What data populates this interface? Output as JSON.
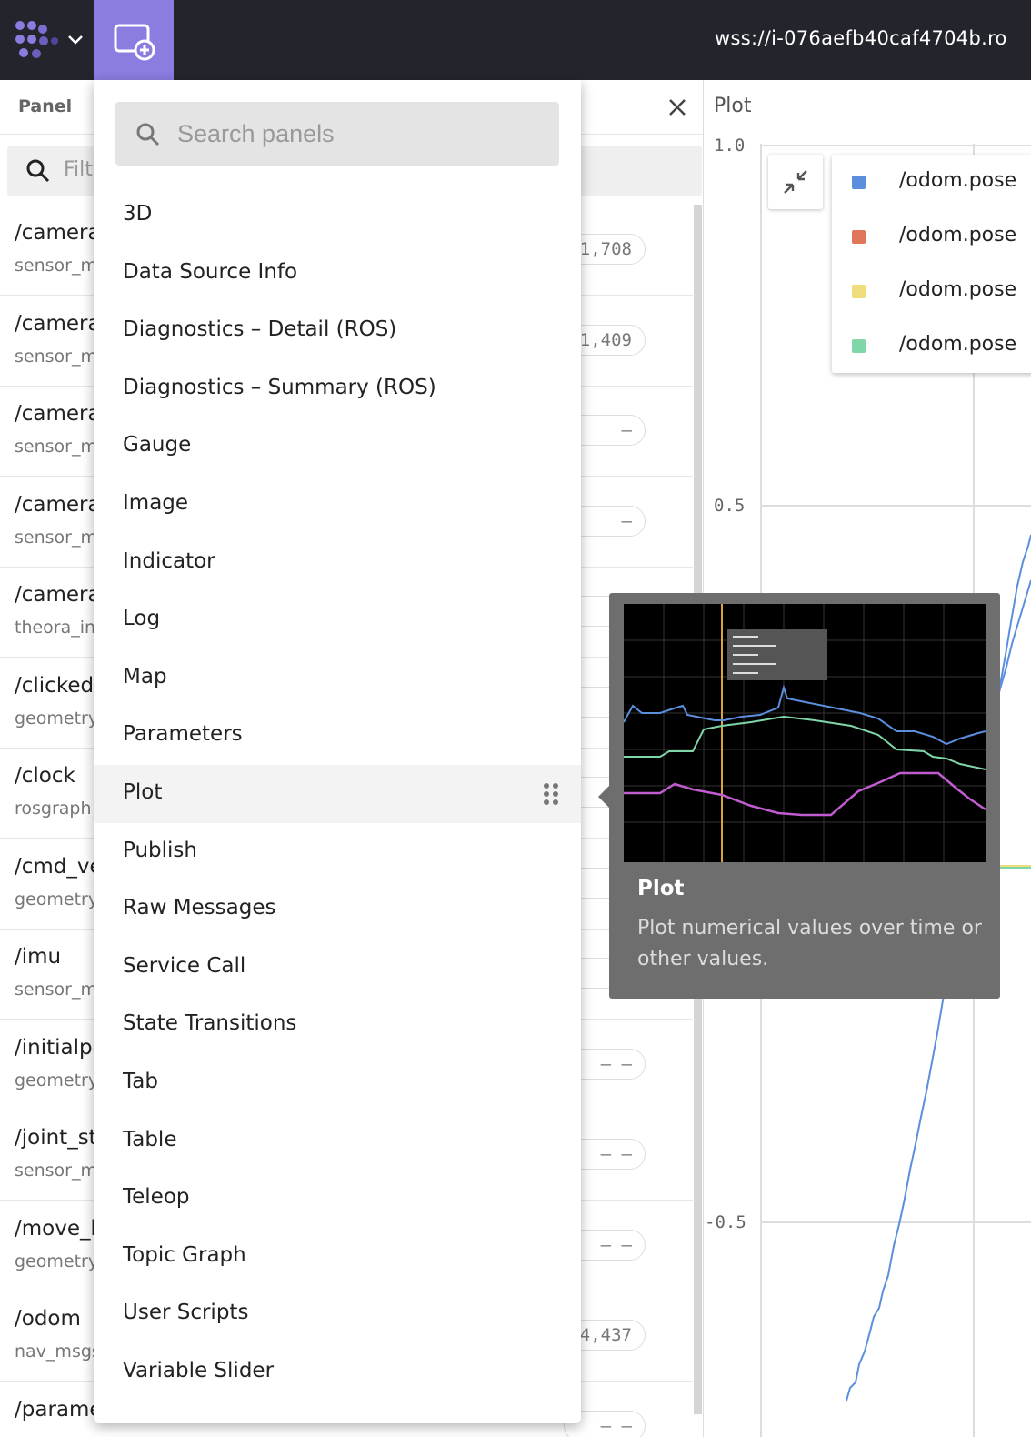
{
  "topbar": {
    "ws_url": "wss://i-076aefb40caf4704b.ro"
  },
  "topics_panel": {
    "title": "Panel",
    "filter_placeholder": "Filt",
    "rows": [
      {
        "name": "/camera",
        "type": "sensor_m",
        "count": "1,708"
      },
      {
        "name": "/camera",
        "type": "sensor_m",
        "count": "1,409"
      },
      {
        "name": "/camera",
        "type": "sensor_m",
        "count": "—"
      },
      {
        "name": "/camera",
        "type": "sensor_m",
        "count": "—"
      },
      {
        "name": "/camera",
        "type": "theora_in",
        "count": "—"
      },
      {
        "name": "/clicked",
        "type": "geometry",
        "count": "—"
      },
      {
        "name": "/clock",
        "type": "rosgraph",
        "count": "—"
      },
      {
        "name": "/cmd_ve",
        "type": "geometry",
        "count": "—"
      },
      {
        "name": "/imu",
        "type": "sensor_m",
        "count": "—"
      },
      {
        "name": "/initialpo",
        "type": "geometry",
        "count": "— —"
      },
      {
        "name": "/joint_st",
        "type": "sensor_m",
        "count": "— —"
      },
      {
        "name": "/move_b",
        "type": "geometry",
        "count": "— —"
      },
      {
        "name": "/odom",
        "type": "nav_msgs",
        "count": "4,437"
      },
      {
        "name": "/parame",
        "type": "",
        "count": "— —"
      }
    ]
  },
  "plot_panel": {
    "title": "Plot",
    "y_ticks": [
      "1.0",
      "0.5",
      "-0.5"
    ],
    "legend": [
      {
        "label": "/odom.pose",
        "color": "#5b8fde"
      },
      {
        "label": "/odom.pose",
        "color": "#e0775a"
      },
      {
        "label": "/odom.pose",
        "color": "#efdc7a"
      },
      {
        "label": "/odom.pose",
        "color": "#7fd6a8"
      }
    ]
  },
  "add_panel_menu": {
    "search_placeholder": "Search panels",
    "items": [
      "3D",
      "Data Source Info",
      "Diagnostics – Detail (ROS)",
      "Diagnostics – Summary (ROS)",
      "Gauge",
      "Image",
      "Indicator",
      "Log",
      "Map",
      "Parameters",
      "Plot",
      "Publish",
      "Raw Messages",
      "Service Call",
      "State Transitions",
      "Tab",
      "Table",
      "Teleop",
      "Topic Graph",
      "User Scripts",
      "Variable Slider"
    ],
    "hovered_item": "Plot"
  },
  "tooltip": {
    "title": "Plot",
    "description": "Plot numerical values over time or other values."
  }
}
